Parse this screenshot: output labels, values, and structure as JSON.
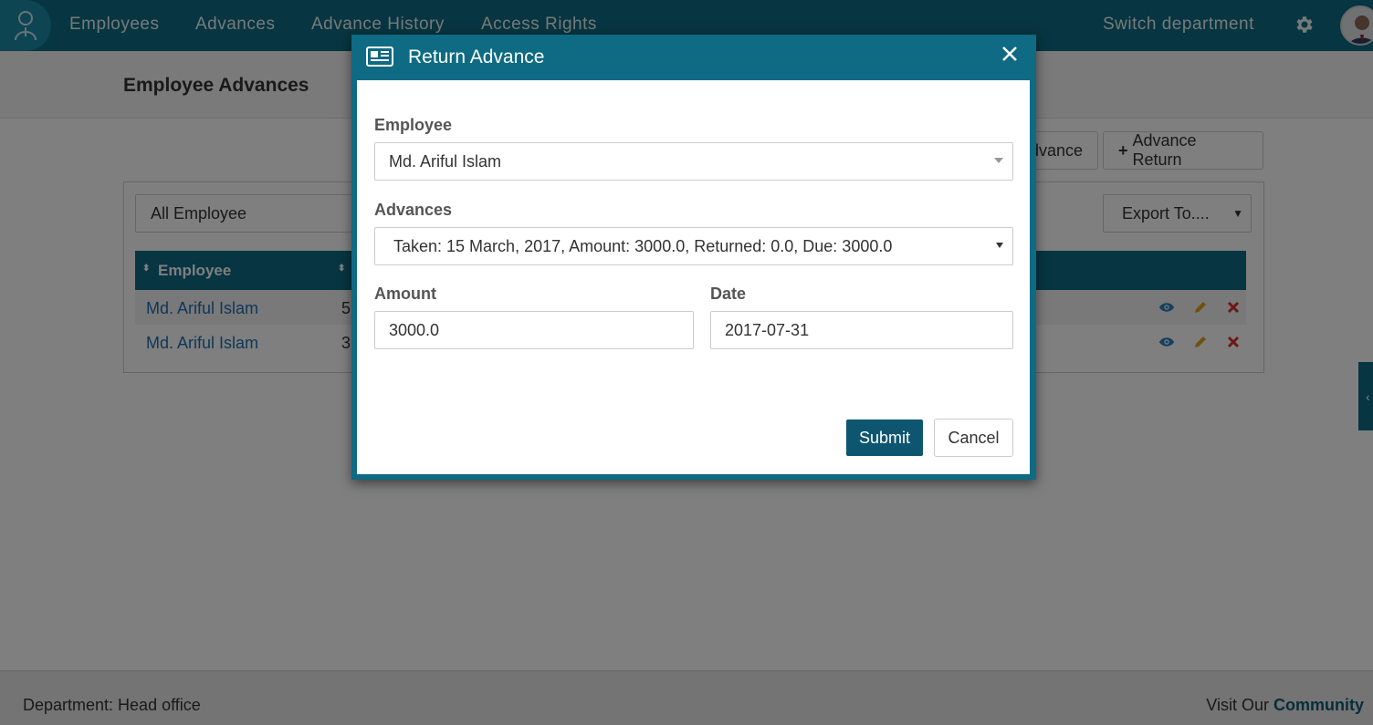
{
  "nav": {
    "items": [
      "Employees",
      "Advances",
      "Advance History",
      "Access Rights"
    ],
    "switch_department": "Switch department"
  },
  "page": {
    "title": "Employee Advances",
    "add_advance_partial": "dvance",
    "advance_return_label": "Advance Return"
  },
  "filters": {
    "employee_select": "All Employee",
    "export_select": "Export To...."
  },
  "table": {
    "columns": [
      "Employee"
    ],
    "rows": [
      {
        "employee": "Md. Ariful Islam",
        "partial_value": "5"
      },
      {
        "employee": "Md. Ariful Islam",
        "partial_value": "3"
      }
    ]
  },
  "footer": {
    "department": "Department: Head office",
    "visit_prefix": "Visit Our",
    "community": "Community"
  },
  "modal": {
    "title": "Return Advance",
    "employee_label": "Employee",
    "employee_value": "Md. Ariful Islam",
    "advances_label": "Advances",
    "advances_value": "Taken: 15 March, 2017, Amount: 3000.0, Returned: 0.0, Due: 3000.0",
    "amount_label": "Amount",
    "amount_value": "3000.0",
    "date_label": "Date",
    "date_value": "2017-07-31",
    "submit_label": "Submit",
    "cancel_label": "Cancel"
  },
  "colors": {
    "primary": "#0e6b83",
    "link": "#1f6fb2",
    "submit": "#0e5570",
    "view_icon": "#2d7fc1",
    "edit_icon": "#e0a020",
    "delete_icon": "#d9302c"
  }
}
